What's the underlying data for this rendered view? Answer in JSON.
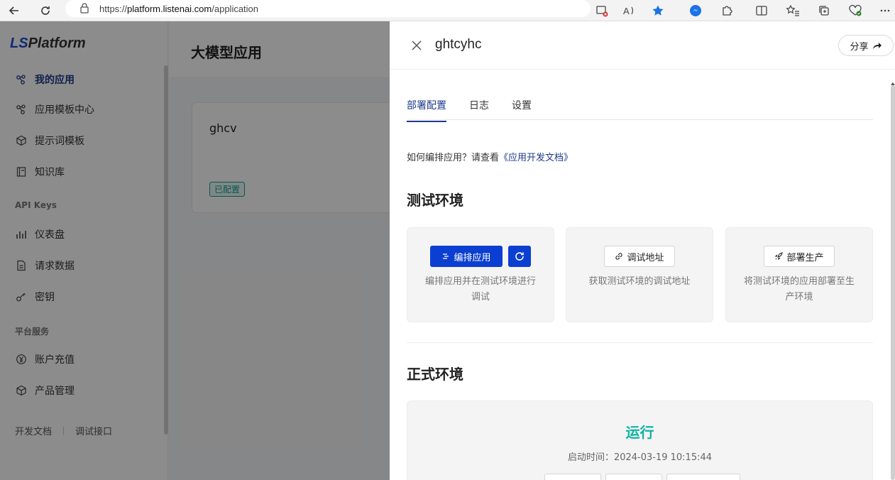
{
  "browser": {
    "url_prefix": "https://",
    "url_host": "platform.listenai.com",
    "url_path": "/application"
  },
  "sidebar": {
    "logo_ls": "LS",
    "logo_rest": "Platform",
    "items": [
      {
        "label": "我的应用",
        "icon": "nodes-icon",
        "active": true
      },
      {
        "label": "应用模板中心",
        "icon": "template-icon"
      },
      {
        "label": "提示词模板",
        "icon": "cube-icon"
      },
      {
        "label": "知识库",
        "icon": "book-icon"
      }
    ],
    "section_api": "API Keys",
    "api_items": [
      {
        "label": "仪表盘",
        "icon": "bar-chart-icon"
      },
      {
        "label": "请求数据",
        "icon": "document-icon"
      },
      {
        "label": "密钥",
        "icon": "key-icon"
      }
    ],
    "section_platform": "平台服务",
    "platform_items": [
      {
        "label": "账户充值",
        "icon": "yen-icon"
      },
      {
        "label": "产品管理",
        "icon": "box-icon"
      }
    ],
    "footer": {
      "docs": "开发文档",
      "debug": "调试接口"
    }
  },
  "main": {
    "title": "大模型应用",
    "card": {
      "name": "ghcv",
      "tag": "已配置"
    }
  },
  "drawer": {
    "title": "ghtcyhc",
    "share_label": "分享",
    "tabs": [
      "部署配置",
      "日志",
      "设置"
    ],
    "help_text": "如何编排应用？请查看",
    "help_link": "《应用开发文档》",
    "test_env": {
      "title": "测试环境",
      "cards": [
        {
          "button": "编排应用",
          "desc": "编排应用并在测试环境进行调试"
        },
        {
          "button": "调试地址",
          "desc": "获取测试环境的调试地址"
        },
        {
          "button": "部署生产",
          "desc": "将测试环境的应用部署至生产环境"
        }
      ]
    },
    "prod_env": {
      "title": "正式环境",
      "status": "运行",
      "start_time": "启动时间：2024-03-19 10:15:44"
    }
  },
  "colors": {
    "primary": "#0b3fd1",
    "nav_active": "#1e3a8a",
    "status_running": "#10b3a3"
  }
}
